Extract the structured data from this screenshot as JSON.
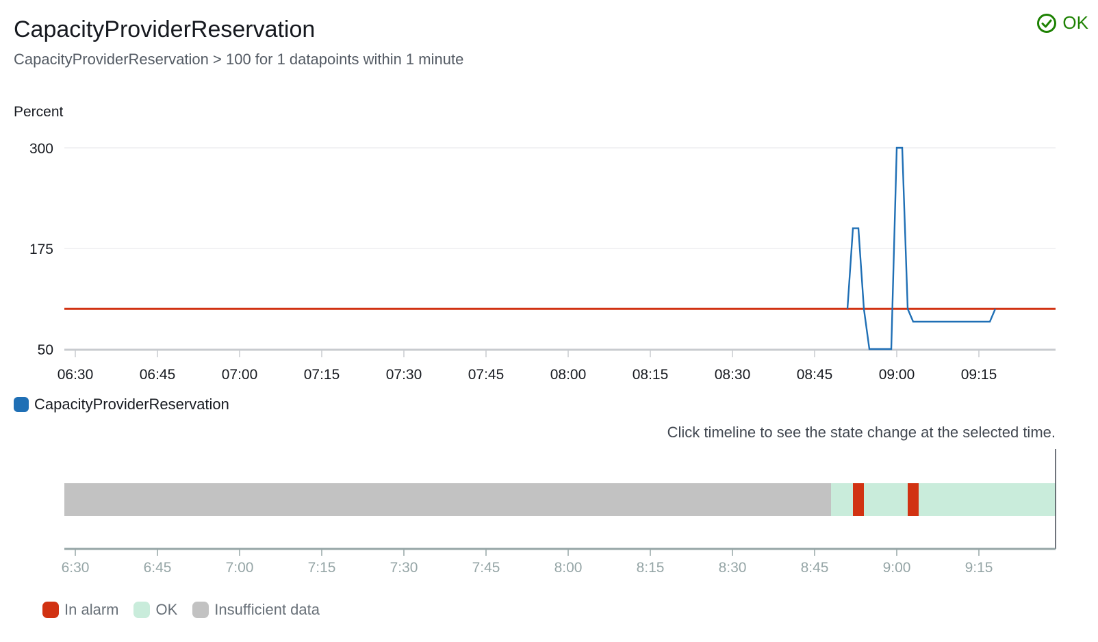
{
  "header": {
    "title": "CapacityProviderReservation",
    "subtitle": "CapacityProviderReservation > 100 for 1 datapoints within 1 minute",
    "status_label": "OK",
    "status_color": "#1d8102",
    "status_icon": "check-circle-icon"
  },
  "chart_data": {
    "type": "line",
    "ylabel": "Percent",
    "ylim": [
      50,
      300
    ],
    "yticks": [
      "300",
      "175",
      "50"
    ],
    "ytick_values": [
      300,
      175,
      50
    ],
    "xlabels": [
      "06:30",
      "06:45",
      "07:00",
      "07:15",
      "07:30",
      "07:45",
      "08:00",
      "08:15",
      "08:30",
      "08:45",
      "09:00",
      "09:15"
    ],
    "xlim_minutes": [
      388,
      569
    ],
    "threshold": 100,
    "threshold_color": "#d13212",
    "series": [
      {
        "name": "CapacityProviderReservation",
        "color": "#1f6fb5",
        "points": [
          [
            "08:51",
            100
          ],
          [
            "08:52",
            200
          ],
          [
            "08:53",
            200
          ],
          [
            "08:54",
            100
          ],
          [
            "08:55",
            50
          ],
          [
            "08:56",
            50
          ],
          [
            "08:57",
            50
          ],
          [
            "08:58",
            50
          ],
          [
            "08:59",
            50
          ],
          [
            "09:00",
            300
          ],
          [
            "09:01",
            300
          ],
          [
            "09:02",
            100
          ],
          [
            "09:03",
            84
          ],
          [
            "09:08",
            84
          ],
          [
            "09:13",
            84
          ],
          [
            "09:17",
            84
          ],
          [
            "09:18",
            100
          ]
        ]
      }
    ]
  },
  "timeline": {
    "hint": "Click timeline to see the state change at the selected time.",
    "xlabels": [
      "6:30",
      "6:45",
      "7:00",
      "7:15",
      "7:30",
      "7:45",
      "8:00",
      "8:15",
      "8:30",
      "8:45",
      "9:00",
      "9:15"
    ],
    "segments": [
      {
        "state": "insufficient",
        "start": "06:28",
        "end": "08:48"
      },
      {
        "state": "ok",
        "start": "08:48",
        "end": "08:52"
      },
      {
        "state": "alarm",
        "start": "08:52",
        "end": "08:54"
      },
      {
        "state": "ok",
        "start": "08:54",
        "end": "09:02"
      },
      {
        "state": "alarm",
        "start": "09:02",
        "end": "09:04"
      },
      {
        "state": "ok",
        "start": "09:04",
        "end": "09:29"
      }
    ],
    "colors": {
      "alarm": "#d13212",
      "ok": "#c9ecdb",
      "insufficient": "#c2c2c2"
    },
    "legend": [
      {
        "state": "alarm",
        "label": "In alarm"
      },
      {
        "state": "ok",
        "label": "OK"
      },
      {
        "state": "insufficient",
        "label": "Insufficient data"
      }
    ]
  }
}
